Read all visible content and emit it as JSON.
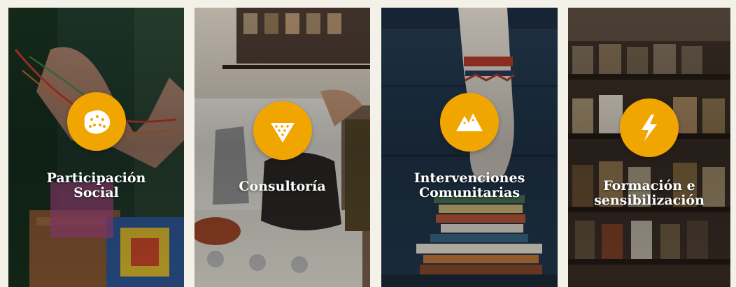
{
  "services": [
    {
      "title_line1": "Participación",
      "title_line2": "Social",
      "icon": "dotted-blob-icon",
      "accent": "#f0a500"
    },
    {
      "title_line1": "Consultoría",
      "title_line2": "",
      "icon": "dotted-triangle-icon",
      "accent": "#f0a500"
    },
    {
      "title_line1": "Intervenciones",
      "title_line2": "Comunitarias",
      "icon": "mountain-icon",
      "accent": "#f0a500"
    },
    {
      "title_line1": "Formación e",
      "title_line2": "sensibilización",
      "icon": "lightning-icon",
      "accent": "#f0a500"
    }
  ]
}
